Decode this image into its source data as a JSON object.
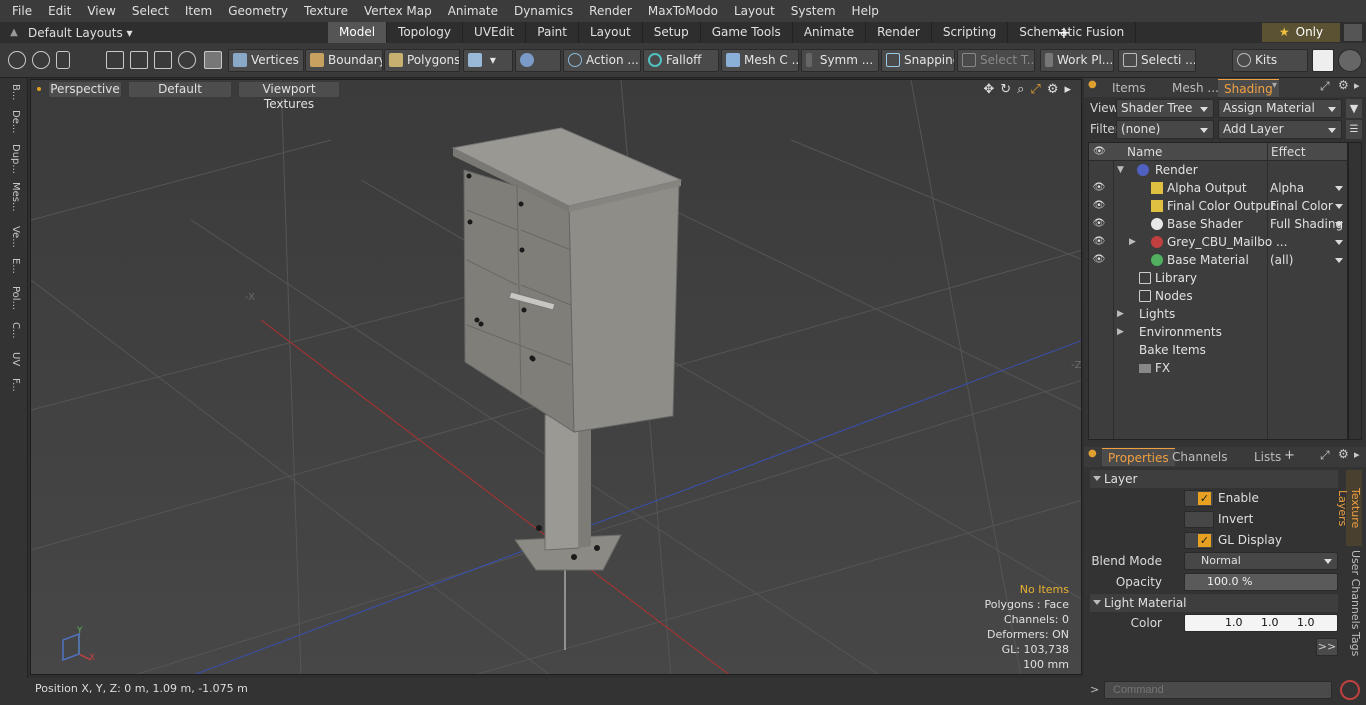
{
  "menu": [
    "File",
    "Edit",
    "View",
    "Select",
    "Item",
    "Geometry",
    "Texture",
    "Vertex Map",
    "Animate",
    "Dynamics",
    "Render",
    "MaxToModo",
    "Layout",
    "System",
    "Help"
  ],
  "layout": {
    "select": "Default Layouts",
    "only": "Only",
    "tabs": [
      "Model",
      "Topology",
      "UVEdit",
      "Paint",
      "Layout",
      "Setup",
      "Game Tools",
      "Animate",
      "Render",
      "Scripting",
      "Schematic Fusion"
    ]
  },
  "toolbar": {
    "vertices": "Vertices",
    "boundary": "Boundary",
    "polygons": "Polygons",
    "action": "Action",
    "falloff": "Falloff",
    "mesh": "Mesh C ...",
    "symm": "Symm ...",
    "snapping": "Snapping",
    "select_t": "Select T...",
    "workpl": "Work Pl...",
    "selecti": "Selecti ...",
    "kits": "Kits"
  },
  "left_tabs": [
    "B...",
    "De...",
    "Dup...",
    "Mes...",
    "Ve...",
    "E...",
    "Pol...",
    "C...",
    "UV",
    "F..."
  ],
  "viewport": {
    "perspective": "Perspective",
    "default": "Default",
    "textures": "Viewport Textures",
    "info": {
      "no_items": "No Items",
      "polygons": "Polygons : Face",
      "channels": "Channels: 0",
      "deformers": "Deformers: ON",
      "gl": "GL: 103,738",
      "scale": "100 mm"
    },
    "axis_minus_x": "-X",
    "axis_minus_z": "-Z",
    "gizmo_x": "X",
    "gizmo_y": "Y"
  },
  "status": {
    "position": "Position X, Y, Z:   0 m, 1.09 m, -1.075 m"
  },
  "panel": {
    "tabs": {
      "items": "Items",
      "mesh": "Mesh ...",
      "shading": "Shading"
    },
    "view_label": "View",
    "view_value": "Shader Tree",
    "assign": "Assign Material",
    "filter_label": "Filter",
    "filter_value": "(none)",
    "add_layer": "Add Layer",
    "col_name": "Name",
    "col_effect": "Effect",
    "tree": [
      {
        "name": "Render",
        "effect": ""
      },
      {
        "name": "Alpha Output",
        "effect": "Alpha"
      },
      {
        "name": "Final Color Output",
        "effect": "Final Color"
      },
      {
        "name": "Base Shader",
        "effect": "Full Shading"
      },
      {
        "name": "Grey_CBU_Mailbo ...",
        "effect": ""
      },
      {
        "name": "Base Material",
        "effect": "(all)"
      },
      {
        "name": "Library",
        "effect": ""
      },
      {
        "name": "Nodes",
        "effect": ""
      },
      {
        "name": "Lights",
        "effect": ""
      },
      {
        "name": "Environments",
        "effect": ""
      },
      {
        "name": "Bake Items",
        "effect": ""
      },
      {
        "name": "FX",
        "effect": ""
      }
    ]
  },
  "properties": {
    "tabs": {
      "properties": "Properties",
      "channels": "Channels",
      "lists": "Lists"
    },
    "layer": "Layer",
    "enable": "Enable",
    "invert": "Invert",
    "gl_display": "GL Display",
    "blend_label": "Blend Mode",
    "blend_value": "Normal",
    "opacity_label": "Opacity",
    "opacity_value": "100.0 %",
    "light_material": "Light Material",
    "color_label": "Color",
    "color_r": "1.0",
    "color_g": "1.0",
    "color_b": "1.0",
    "side_tabs": {
      "texture_layers": "Texture Layers",
      "user_channels": "User Channels",
      "tags": "Tags"
    },
    "more": ">>",
    "command_placeholder": "Command"
  }
}
